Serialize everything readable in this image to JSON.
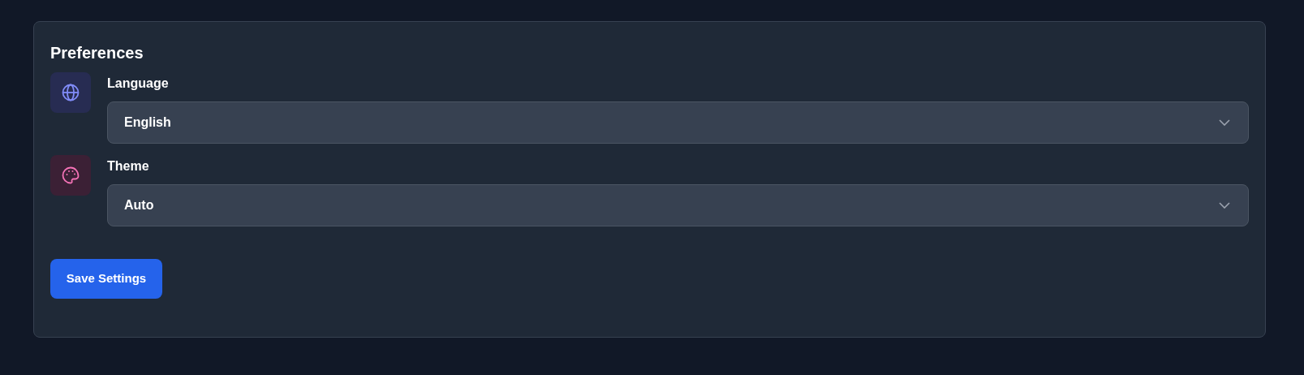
{
  "card": {
    "title": "Preferences"
  },
  "settings": [
    {
      "kind": "language",
      "label": "Language",
      "value": "English"
    },
    {
      "kind": "theme",
      "label": "Theme",
      "value": "Auto"
    }
  ],
  "save_button": {
    "label": "Save Settings"
  }
}
